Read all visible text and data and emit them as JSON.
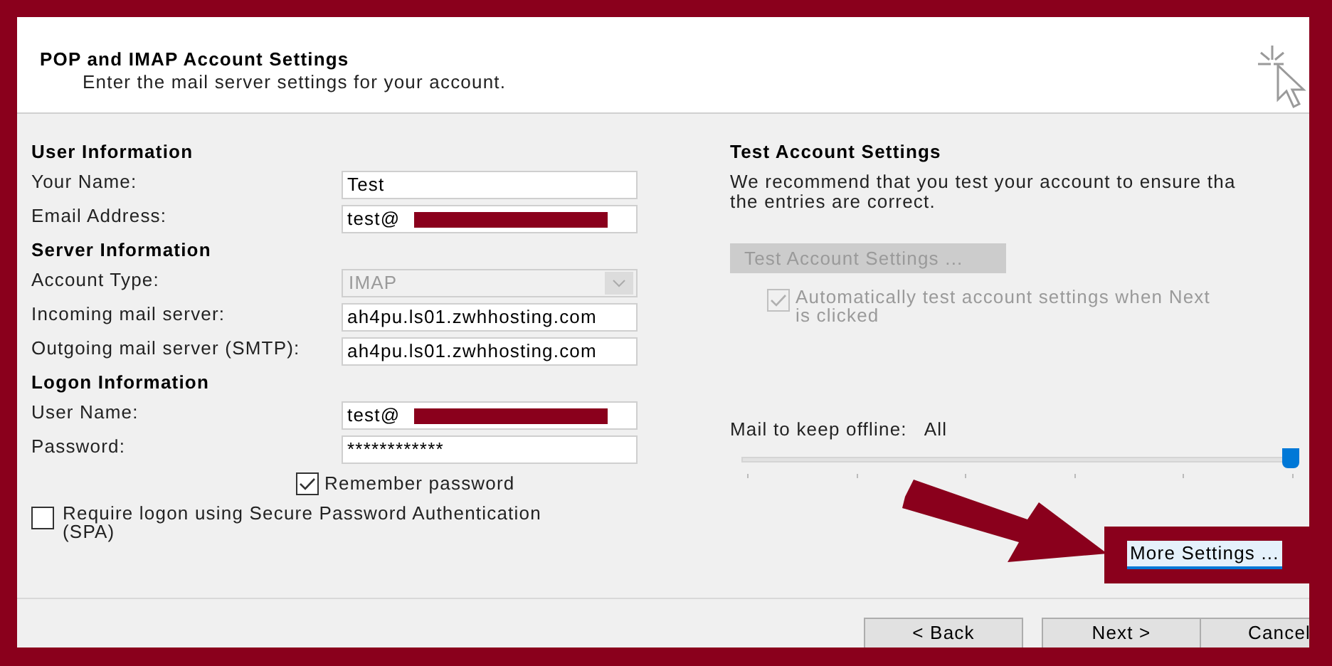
{
  "header": {
    "title": "POP and IMAP Account Settings",
    "subtitle": "Enter the mail server settings for your account."
  },
  "sections": [
    {
      "heading": "User Information",
      "fields": [
        {
          "kind": "text",
          "label": "Your Name:",
          "value": "Test",
          "redacted": false
        },
        {
          "kind": "text",
          "label": "Email Address:",
          "value": "test@",
          "redacted": true
        }
      ]
    },
    {
      "heading": "Server Information",
      "fields": [
        {
          "kind": "dropdown",
          "label": "Account Type:",
          "value": "IMAP",
          "disabled": true
        },
        {
          "kind": "text",
          "label": "Incoming mail server:",
          "value": "ah4pu.ls01.zwhhosting.com",
          "redacted": false
        },
        {
          "kind": "text",
          "label": "Outgoing mail server (SMTP):",
          "value": "ah4pu.ls01.zwhhosting.com",
          "redacted": false
        }
      ]
    },
    {
      "heading": "Logon Information",
      "fields": [
        {
          "kind": "text",
          "label": "User Name:",
          "value": "test@",
          "redacted": true
        },
        {
          "kind": "text",
          "label": "Password:",
          "value": "************",
          "redacted": false
        }
      ]
    }
  ],
  "remember_password": {
    "label": "Remember password",
    "checked": true
  },
  "spa": {
    "label": "Require logon using Secure Password Authentication\n(SPA)",
    "checked": false
  },
  "test_settings": {
    "heading": "Test Account Settings",
    "description": "We recommend that you test your account to ensure tha\nthe entries are correct.",
    "button": {
      "label": "Test Account Settings ...",
      "disabled": true
    },
    "auto_test": {
      "label": "Automatically test account settings when Next\nis clicked",
      "checked": true,
      "disabled": true
    }
  },
  "offline": {
    "label": "Mail to keep offline:",
    "value": "All",
    "level": 1
  },
  "more_settings_button": {
    "label": "More Settings ..."
  },
  "buttons": [
    {
      "label": "< Back"
    },
    {
      "label": "Next >"
    },
    {
      "label": "Cancel"
    }
  ]
}
